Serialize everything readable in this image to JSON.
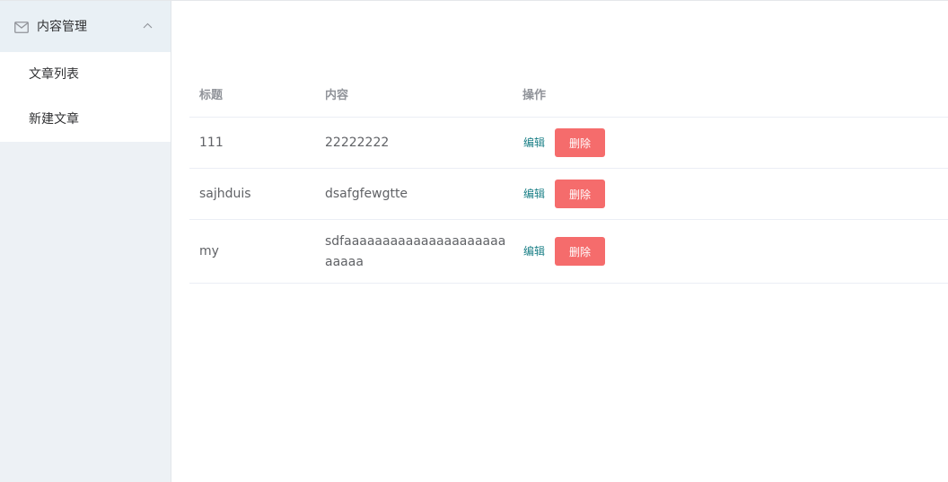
{
  "sidebar": {
    "group": {
      "icon": "mail-icon",
      "label": "内容管理",
      "chevron": "chevron-up-icon"
    },
    "items": [
      {
        "label": "文章列表"
      },
      {
        "label": "新建文章"
      }
    ]
  },
  "table": {
    "headers": {
      "title": "标题",
      "content": "内容",
      "ops": "操作"
    },
    "rows": [
      {
        "title": "111",
        "content": "22222222",
        "edit": "编辑",
        "delete": "删除"
      },
      {
        "title": "sajhduis",
        "content": "dsafgfewgtte",
        "edit": "编辑",
        "delete": "删除"
      },
      {
        "title": "my",
        "content": "sdfaaaaaaaaaaaaaaaaaaaaaaaaaa",
        "edit": "编辑",
        "delete": "删除"
      }
    ]
  },
  "colors": {
    "sidebar_bg": "#edf1f5",
    "edit_link": "#1a7f86",
    "delete_button": "#f56c6c"
  }
}
